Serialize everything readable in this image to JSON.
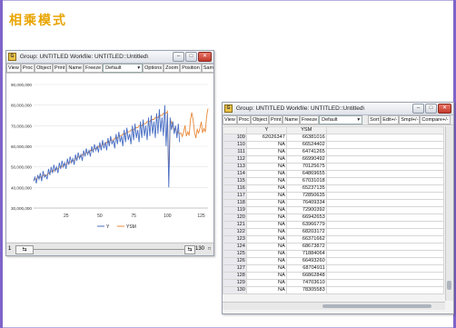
{
  "slide": {
    "title": "相乘模式",
    "accent_color": "#7f63c9",
    "title_color": "#e8a400"
  },
  "window1": {
    "title": "Group: UNTITLED   Workfile: UNTITLED::Untitled\\",
    "icon_label": "G",
    "toolbar": [
      "View",
      "Proc",
      "Object",
      "Print",
      "Name",
      "Freeze"
    ],
    "dropdown_value": "Default",
    "toolbar2": [
      "Options",
      "Zoom",
      "Position",
      "Sample",
      "A"
    ],
    "scroll_left_label": "1",
    "scroll_right_label": "130",
    "scroll_right_marker": "□"
  },
  "window2": {
    "title": "Group: UNTITLED   Workfile: UNTITLED::Untitled\\",
    "icon_label": "G",
    "toolbar": [
      "View",
      "Proc",
      "Object",
      "Print",
      "Name",
      "Freeze"
    ],
    "dropdown_value": "Default",
    "toolbar2": [
      "Sort",
      "Edit+/-",
      "Smpl+/-",
      "Compare+/-"
    ],
    "col_headers": [
      "",
      "Y",
      "YSM"
    ],
    "rows": [
      [
        "109",
        "62026347",
        "66381016"
      ],
      [
        "110",
        "NA",
        "66524402"
      ],
      [
        "111",
        "NA",
        "64741265"
      ],
      [
        "112",
        "NA",
        "66990492"
      ],
      [
        "113",
        "NA",
        "70125675"
      ],
      [
        "114",
        "NA",
        "64869655"
      ],
      [
        "115",
        "NA",
        "67031018"
      ],
      [
        "116",
        "NA",
        "65237135"
      ],
      [
        "117",
        "NA",
        "72850635"
      ],
      [
        "118",
        "NA",
        "76409334"
      ],
      [
        "119",
        "NA",
        "72900392"
      ],
      [
        "120",
        "NA",
        "66942653"
      ],
      [
        "121",
        "NA",
        "63966779"
      ],
      [
        "122",
        "NA",
        "68203172"
      ],
      [
        "123",
        "NA",
        "66371662"
      ],
      [
        "124",
        "NA",
        "68673872"
      ],
      [
        "125",
        "NA",
        "71884064"
      ],
      [
        "126",
        "NA",
        "66493260"
      ],
      [
        "127",
        "NA",
        "68704911"
      ],
      [
        "128",
        "NA",
        "66862848"
      ],
      [
        "129",
        "NA",
        "74703610"
      ],
      [
        "130",
        "NA",
        "78305583"
      ]
    ]
  },
  "chart_data": {
    "type": "line",
    "x": [
      1,
      2,
      3,
      4,
      5,
      6,
      7,
      8,
      9,
      10,
      11,
      12,
      13,
      14,
      15,
      16,
      17,
      18,
      19,
      20,
      21,
      22,
      23,
      24,
      25,
      26,
      27,
      28,
      29,
      30,
      31,
      32,
      33,
      34,
      35,
      36,
      37,
      38,
      39,
      40,
      41,
      42,
      43,
      44,
      45,
      46,
      47,
      48,
      49,
      50,
      51,
      52,
      53,
      54,
      55,
      56,
      57,
      58,
      59,
      60,
      61,
      62,
      63,
      64,
      65,
      66,
      67,
      68,
      69,
      70,
      71,
      72,
      73,
      74,
      75,
      76,
      77,
      78,
      79,
      80,
      81,
      82,
      83,
      84,
      85,
      86,
      87,
      88,
      89,
      90,
      91,
      92,
      93,
      94,
      95,
      96,
      97,
      98,
      99,
      100,
      101,
      102,
      103,
      104,
      105,
      106,
      107,
      108,
      109,
      110,
      111,
      112,
      113,
      114,
      115,
      116,
      117,
      118,
      119,
      120,
      121,
      122,
      123,
      124,
      125,
      126,
      127,
      128,
      129,
      130
    ],
    "series": [
      {
        "name": "Y",
        "color": "#4a6fc4",
        "values": [
          43,
          45,
          42,
          46,
          44,
          47,
          43,
          48,
          45,
          46,
          44,
          49,
          46,
          50,
          47,
          51,
          48,
          50,
          47,
          52,
          49,
          53,
          50,
          52,
          49,
          54,
          51,
          55,
          52,
          54,
          51,
          56,
          53,
          57,
          54,
          56,
          53,
          58,
          55,
          59,
          56,
          58,
          55,
          60,
          57,
          61,
          58,
          60,
          57,
          62,
          58,
          63,
          59,
          62,
          58,
          64,
          60,
          65,
          61,
          63,
          59,
          66,
          61,
          67,
          62,
          65,
          60,
          68,
          62,
          69,
          63,
          66,
          61,
          70,
          63,
          71,
          64,
          68,
          62,
          72,
          64,
          73,
          65,
          70,
          63,
          74,
          65,
          75,
          66,
          72,
          64,
          76,
          66,
          78,
          67,
          74,
          65,
          80,
          60,
          76,
          40,
          74,
          68,
          72,
          66,
          70,
          64,
          71,
          62,
          null,
          null,
          null,
          null,
          null,
          null,
          null,
          null,
          null,
          null,
          null,
          null,
          null,
          null,
          null,
          null,
          null,
          null,
          null,
          null,
          null
        ]
      },
      {
        "name": "YSM",
        "color": "#e8893a",
        "values": [
          44,
          44,
          44,
          45,
          45,
          45,
          45,
          46,
          46,
          46,
          46,
          47,
          47,
          48,
          48,
          48,
          49,
          49,
          49,
          50,
          50,
          50,
          51,
          51,
          51,
          52,
          52,
          52,
          53,
          53,
          53,
          54,
          54,
          55,
          55,
          55,
          56,
          56,
          56,
          57,
          57,
          57,
          58,
          58,
          58,
          59,
          59,
          59,
          60,
          60,
          60,
          61,
          61,
          61,
          62,
          62,
          62,
          63,
          63,
          63,
          64,
          64,
          64,
          65,
          65,
          65,
          66,
          66,
          66,
          67,
          67,
          67,
          68,
          68,
          68,
          69,
          69,
          69,
          70,
          70,
          70,
          71,
          71,
          71,
          72,
          72,
          72,
          73,
          73,
          73,
          74,
          74,
          74,
          75,
          75,
          75,
          76,
          76,
          76,
          77,
          45,
          70,
          72,
          70,
          68,
          69,
          66,
          67,
          66,
          66.5,
          64.7,
          67,
          70.1,
          64.9,
          67,
          65.2,
          72.9,
          76.4,
          72.9,
          66.9,
          64,
          68.2,
          66.4,
          68.7,
          71.9,
          66.5,
          68.7,
          66.9,
          74.7,
          78.3
        ]
      }
    ],
    "y_tick_labels": [
      "30,000,000",
      "40,000,000",
      "50,000,000",
      "60,000,000",
      "70,000,000",
      "80,000,000",
      "90,000,000"
    ],
    "x_tick_labels": [
      "25",
      "50",
      "75",
      "100",
      "125"
    ],
    "x_ticks": [
      25,
      50,
      75,
      100,
      125
    ],
    "ylim": [
      30,
      90
    ],
    "xlim": [
      1,
      130
    ],
    "grid": true,
    "legend_position": "bottom"
  }
}
